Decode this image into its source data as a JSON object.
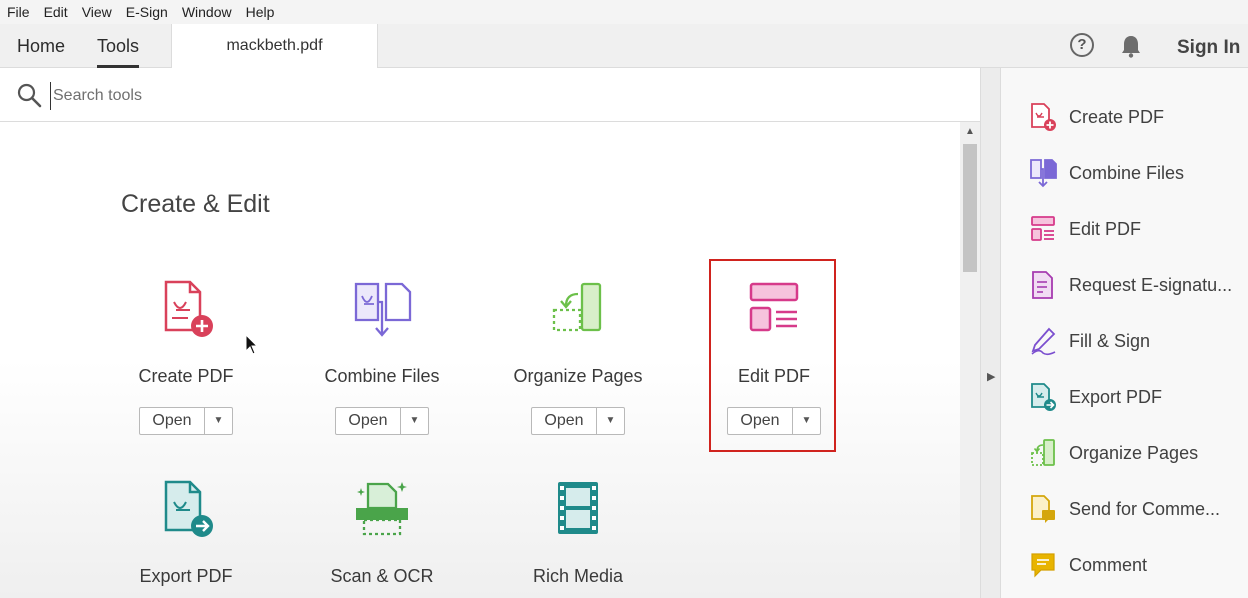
{
  "menu": [
    "File",
    "Edit",
    "View",
    "E-Sign",
    "Window",
    "Help"
  ],
  "tabs": {
    "home": "Home",
    "tools": "Tools",
    "document": "mackbeth.pdf"
  },
  "header": {
    "help_glyph": "?",
    "sign_in": "Sign In"
  },
  "search": {
    "placeholder": "Search tools"
  },
  "section": {
    "title": "Create & Edit"
  },
  "tools": [
    {
      "label": "Create PDF",
      "icon": "create-pdf-icon",
      "color": "#d9415a",
      "open": "Open",
      "dd": "▼"
    },
    {
      "label": "Combine Files",
      "icon": "combine-files-icon",
      "color": "#7b68d6",
      "open": "Open",
      "dd": "▼"
    },
    {
      "label": "Organize Pages",
      "icon": "organize-pages-icon",
      "color": "#6cc04a",
      "open": "Open",
      "dd": "▼"
    },
    {
      "label": "Edit PDF",
      "icon": "edit-pdf-icon",
      "color": "#d63a8a",
      "open": "Open",
      "dd": "▼"
    },
    {
      "label": "Export PDF",
      "icon": "export-pdf-icon",
      "color": "#1f8a8a"
    },
    {
      "label": "Scan & OCR",
      "icon": "scan-ocr-icon",
      "color": "#4aa44a"
    },
    {
      "label": "Rich Media",
      "icon": "rich-media-icon",
      "color": "#1f8a8a"
    }
  ],
  "scroll": {
    "up_glyph": "▲"
  },
  "collapse": {
    "glyph": "▶"
  },
  "right_panel": [
    {
      "label": "Create PDF",
      "icon": "create-pdf-icon"
    },
    {
      "label": "Combine Files",
      "icon": "combine-files-icon"
    },
    {
      "label": "Edit PDF",
      "icon": "edit-pdf-icon"
    },
    {
      "label": "Request E-signatu...",
      "icon": "request-esign-icon"
    },
    {
      "label": "Fill & Sign",
      "icon": "fill-sign-icon"
    },
    {
      "label": "Export PDF",
      "icon": "export-pdf-icon"
    },
    {
      "label": "Organize Pages",
      "icon": "organize-pages-icon"
    },
    {
      "label": "Send for Comme...",
      "icon": "send-comment-icon"
    },
    {
      "label": "Comment",
      "icon": "comment-icon"
    }
  ],
  "colors": {
    "highlight": "#d0231e",
    "accent_red": "#d9415a"
  }
}
